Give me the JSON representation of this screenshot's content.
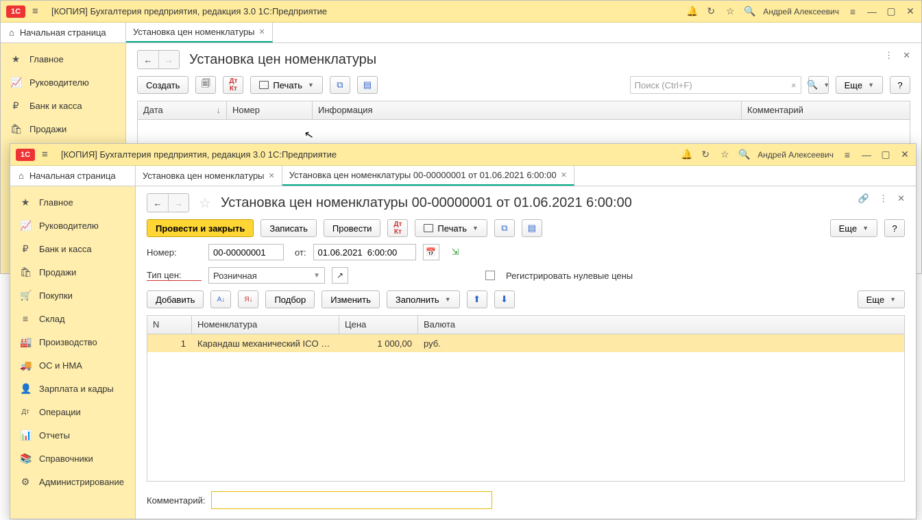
{
  "app": {
    "title": "[КОПИЯ] Бухгалтерия предприятия, редакция 3.0 1C:Предприятие",
    "user": "Андрей Алексеевич",
    "logo": "1C"
  },
  "home_tab": "Начальная страница",
  "sidebar": {
    "items": [
      {
        "icon": "★",
        "label": "Главное"
      },
      {
        "icon": "📈",
        "label": "Руководителю"
      },
      {
        "icon": "₽",
        "label": "Банк и касса"
      },
      {
        "icon": "🛍",
        "label": "Продажи"
      },
      {
        "icon": "🛒",
        "label": "Покупки"
      },
      {
        "icon": "≡",
        "label": "Склад"
      },
      {
        "icon": "🏭",
        "label": "Производство"
      },
      {
        "icon": "🚚",
        "label": "ОС и НМА"
      },
      {
        "icon": "👤",
        "label": "Зарплата и кадры"
      },
      {
        "icon": "Дт",
        "label": "Операции"
      },
      {
        "icon": "📊",
        "label": "Отчеты"
      },
      {
        "icon": "📚",
        "label": "Справочники"
      },
      {
        "icon": "⚙",
        "label": "Администрирование"
      }
    ]
  },
  "w1": {
    "tab1": "Установка цен номенклатуры",
    "title": "Установка цен номенклатуры",
    "btn_create": "Создать",
    "btn_print": "Печать",
    "search_placeholder": "Поиск (Ctrl+F)",
    "btn_more": "Еще",
    "cols": {
      "date": "Дата",
      "num": "Номер",
      "info": "Информация",
      "comm": "Комментарий"
    }
  },
  "w2": {
    "tab1": "Установка цен номенклатуры",
    "tab2": "Установка цен номенклатуры 00-00000001 от 01.06.2021 6:00:00",
    "title": "Установка цен номенклатуры 00-00000001 от 01.06.2021 6:00:00",
    "btn_post_close": "Провести и закрыть",
    "btn_save": "Записать",
    "btn_post": "Провести",
    "btn_print": "Печать",
    "btn_more": "Еще",
    "lbl_num": "Номер:",
    "val_num": "00-00000001",
    "lbl_from": "от:",
    "val_date": "01.06.2021  6:00:00",
    "lbl_type": "Тип цен:",
    "val_type": "Розничная",
    "chk_zero": "Регистрировать нулевые цены",
    "btn_add": "Добавить",
    "btn_select": "Подбор",
    "btn_change": "Изменить",
    "btn_fill": "Заполнить",
    "cols": {
      "n": "N",
      "nom": "Номенклатура",
      "price": "Цена",
      "cur": "Валюта"
    },
    "row1": {
      "n": "1",
      "nom": "Карандаш механический ICO …",
      "price": "1 000,00",
      "cur": "руб."
    },
    "lbl_comment": "Комментарий:",
    "val_comment": ""
  }
}
